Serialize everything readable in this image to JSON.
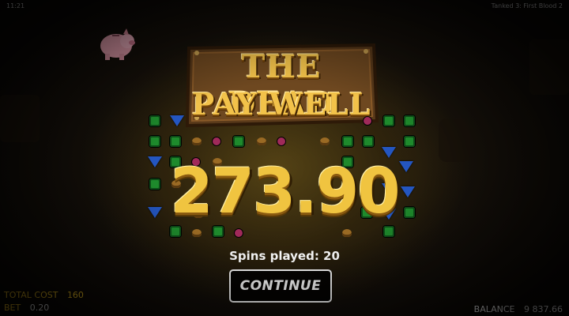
{
  "status_bar": {
    "time": "11:21",
    "game_title": "Tanked 3: First Blood 2"
  },
  "banner": {
    "line1": "THE DEAD",
    "line2": "PAY WELL"
  },
  "win": {
    "amount": "273.90",
    "spins_played": "Spins played: 20"
  },
  "continue_button": {
    "label": "CONTINUE"
  },
  "footer": {
    "total_cost_label": "TOTAL COST",
    "total_cost_value": "160",
    "bet_label": "BET",
    "bet_value": "0.20",
    "balance_label": "BALANCE",
    "balance_value": "9 837.66"
  },
  "icons": [
    "piggy-bank-icon",
    "emerald-gem-icon",
    "sapphire-gem-icon",
    "gold-nugget-icon",
    "ruby-gem-icon"
  ],
  "colors": {
    "gold_text": "#f0c440",
    "footer_label": "#f0c020",
    "button_border": "#ffffff"
  }
}
